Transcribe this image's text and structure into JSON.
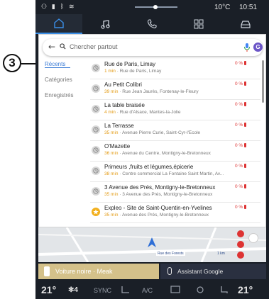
{
  "callout": {
    "number": "3"
  },
  "statusbar": {
    "icons": "⚇ ▮ ᛒ ≋",
    "temperature": "10°C",
    "time": "10:51"
  },
  "topnav": {
    "items": [
      "home-icon",
      "music-icon",
      "phone-icon",
      "apps-icon",
      "car-icon"
    ],
    "active": 0
  },
  "search": {
    "placeholder": "Chercher partout",
    "avatar_letter": "G"
  },
  "sidebar": {
    "items": [
      "Récents",
      "Catégories",
      "Enregistrés"
    ],
    "active": 0
  },
  "results": [
    {
      "title": "Rue de Paris, Limay",
      "duration": "1 min",
      "address": "· Rue de Paris, Limay",
      "battery": "0 %",
      "icon": "history-icon"
    },
    {
      "title": "Au Petit Colibri",
      "duration": "39 min",
      "address": "· Rue Jean Jaurès, Fontenay-le-Fleury",
      "battery": "0 %",
      "icon": "history-icon"
    },
    {
      "title": "La table braisée",
      "duration": "4 min",
      "address": "· Rue d'Alsace, Mantes-la-Jolie",
      "battery": "0 %",
      "icon": "history-icon"
    },
    {
      "title": "La Terrasse",
      "duration": "35 min",
      "address": "· Avenue Pierre Curie, Saint-Cyr-l'École",
      "battery": "0 %",
      "icon": "history-icon"
    },
    {
      "title": "O'Mazette",
      "duration": "36 min",
      "address": "· Avenue du Centre, Montigny-le-Bretonneux",
      "battery": "0 %",
      "icon": "history-icon"
    },
    {
      "title": "Primeurs ,fruits et légumes,épicerie",
      "duration": "38 min",
      "address": "· Centre commercial La Fontaine Saint Martin, Av...",
      "battery": "0 %",
      "icon": "history-icon"
    },
    {
      "title": "3 Avenue des Prés, Montigny-le-Bretonneux",
      "duration": "35 min",
      "address": "· 3 Avenue des Prés, Montigny-le-Bretonneux",
      "battery": "0 %",
      "icon": "history-icon"
    },
    {
      "title": "Expleo - Site de Saint-Quentin-en-Yvelines",
      "duration": "35 min",
      "address": "· Avenue des Prés, Montigny-le-Bretonneux",
      "battery": "0 %",
      "icon": "star-icon"
    }
  ],
  "map": {
    "street": "Rue des Forests",
    "zoom": "1 km"
  },
  "media": {
    "text": "Voiture noire · Meak"
  },
  "assistant": {
    "text": "Assistant Google"
  },
  "climate": {
    "temp_left": "21°",
    "fan_level": "4",
    "sync": "SYNC",
    "ac": "A/C",
    "temp_right": "21°"
  },
  "colors": {
    "accent": "#3a8ee6",
    "duration": "#e39a12",
    "battery": "#dd3333",
    "star": "#f2b01e"
  }
}
